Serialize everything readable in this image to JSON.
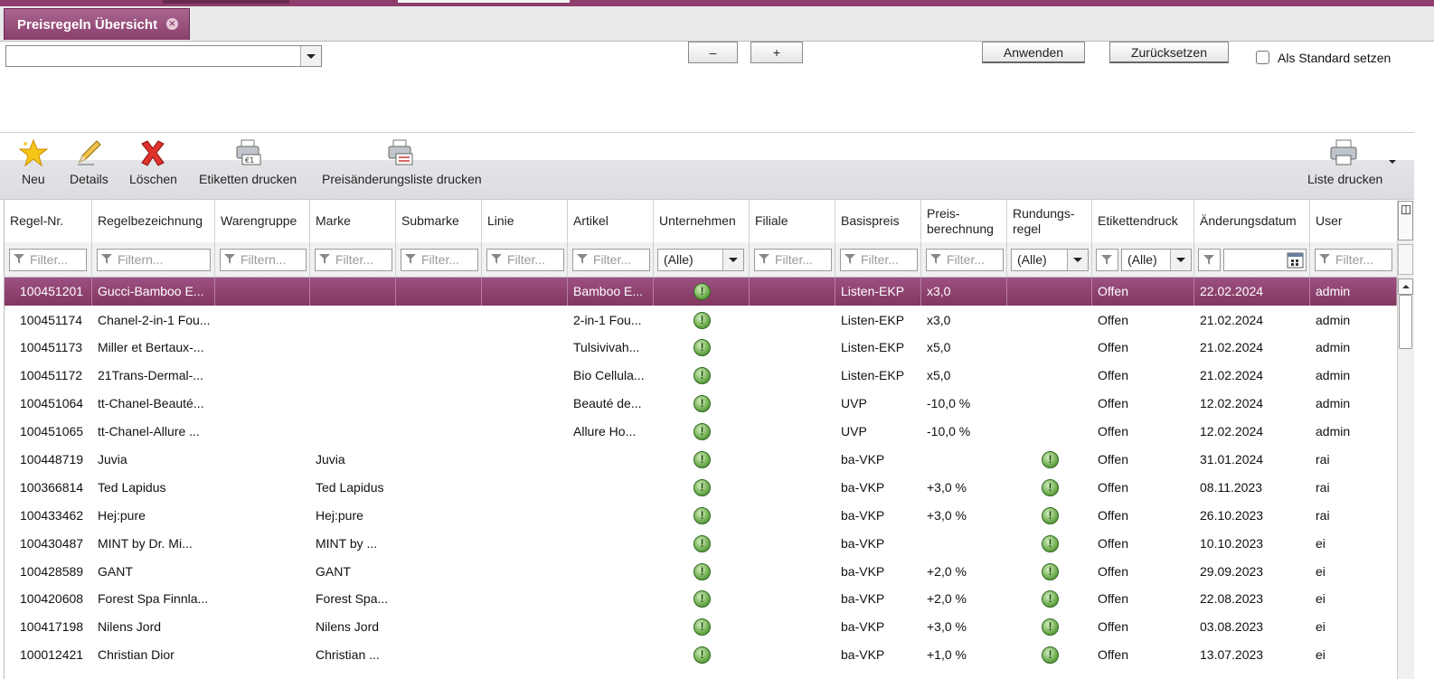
{
  "tab": {
    "title": "Preisregeln Übersicht"
  },
  "filter": {
    "combo_value": "",
    "minus_label": "–",
    "plus_label": "+",
    "apply_label": "Anwenden",
    "reset_label": "Zurücksetzen",
    "default_label": "Als Standard setzen",
    "default_checked": false
  },
  "toolbar": {
    "new": "Neu",
    "details": "Details",
    "delete": "Löschen",
    "print_labels": "Etiketten drucken",
    "print_price_changes": "Preisänderungsliste drucken",
    "print_list": "Liste drucken"
  },
  "columns": {
    "regel_nr": "Regel-Nr.",
    "regelbezeichnung": "Regelbezeichnung",
    "warengruppe": "Warengruppe",
    "marke": "Marke",
    "submarke": "Submarke",
    "linie": "Linie",
    "artikel": "Artikel",
    "unternehmen": "Unternehmen",
    "filiale": "Filiale",
    "basispreis": "Basispreis",
    "preisberechnung_1": "Preis-",
    "preisberechnung_2": "berechnung",
    "rundungsregel_1": "Rundungs-",
    "rundungsregel_2": "regel",
    "etikettendruck": "Etikettendruck",
    "aenderungsdatum": "Änderungsdatum",
    "user": "User"
  },
  "filters": {
    "placeholder_a": "Filter...",
    "placeholder_b": "Filtern...",
    "placeholder_c": "Filtern...",
    "all": "(Alle)"
  },
  "rows": [
    {
      "nr": "100451201",
      "bez": "Gucci-Bamboo E...",
      "wg": "",
      "marke": "",
      "sub": "",
      "linie": "",
      "artikel": "Bamboo E...",
      "unt": true,
      "fil": "",
      "basis": "Listen-EKP",
      "preis": "x3,0",
      "rund": false,
      "etik": "Offen",
      "datum": "22.02.2024",
      "user": "admin",
      "selected": true
    },
    {
      "nr": "100451174",
      "bez": "Chanel-2-in-1 Fou...",
      "wg": "",
      "marke": "",
      "sub": "",
      "linie": "",
      "artikel": "2-in-1 Fou...",
      "unt": true,
      "fil": "",
      "basis": "Listen-EKP",
      "preis": "x3,0",
      "rund": false,
      "etik": "Offen",
      "datum": "21.02.2024",
      "user": "admin"
    },
    {
      "nr": "100451173",
      "bez": "Miller et Bertaux-...",
      "wg": "",
      "marke": "",
      "sub": "",
      "linie": "",
      "artikel": "Tulsivivah...",
      "unt": true,
      "fil": "",
      "basis": "Listen-EKP",
      "preis": "x5,0",
      "rund": false,
      "etik": "Offen",
      "datum": "21.02.2024",
      "user": "admin"
    },
    {
      "nr": "100451172",
      "bez": "21Trans-Dermal-...",
      "wg": "",
      "marke": "",
      "sub": "",
      "linie": "",
      "artikel": "Bio Cellula...",
      "unt": true,
      "fil": "",
      "basis": "Listen-EKP",
      "preis": "x5,0",
      "rund": false,
      "etik": "Offen",
      "datum": "21.02.2024",
      "user": "admin"
    },
    {
      "nr": "100451064",
      "bez": "tt-Chanel-Beauté...",
      "wg": "",
      "marke": "",
      "sub": "",
      "linie": "",
      "artikel": "Beauté de...",
      "unt": true,
      "fil": "",
      "basis": "UVP",
      "preis": "-10,0 %",
      "rund": false,
      "etik": "Offen",
      "datum": "12.02.2024",
      "user": "admin"
    },
    {
      "nr": "100451065",
      "bez": "tt-Chanel-Allure ...",
      "wg": "",
      "marke": "",
      "sub": "",
      "linie": "",
      "artikel": "Allure Ho...",
      "unt": true,
      "fil": "",
      "basis": "UVP",
      "preis": "-10,0 %",
      "rund": false,
      "etik": "Offen",
      "datum": "12.02.2024",
      "user": "admin"
    },
    {
      "nr": "100448719",
      "bez": "Juvia",
      "wg": "",
      "marke": "Juvia",
      "sub": "",
      "linie": "",
      "artikel": "",
      "unt": true,
      "fil": "",
      "basis": "ba-VKP",
      "preis": "",
      "rund": true,
      "etik": "Offen",
      "datum": "31.01.2024",
      "user": "rai"
    },
    {
      "nr": "100366814",
      "bez": "Ted Lapidus",
      "wg": "",
      "marke": "Ted Lapidus",
      "sub": "",
      "linie": "",
      "artikel": "",
      "unt": true,
      "fil": "",
      "basis": "ba-VKP",
      "preis": "+3,0 %",
      "rund": true,
      "etik": "Offen",
      "datum": "08.11.2023",
      "user": "rai"
    },
    {
      "nr": "100433462",
      "bez": "Hej:pure",
      "wg": "",
      "marke": "Hej:pure",
      "sub": "",
      "linie": "",
      "artikel": "",
      "unt": true,
      "fil": "",
      "basis": "ba-VKP",
      "preis": "+3,0 %",
      "rund": true,
      "etik": "Offen",
      "datum": "26.10.2023",
      "user": "rai"
    },
    {
      "nr": "100430487",
      "bez": "MINT by Dr. Mi...",
      "wg": "",
      "marke": "MINT by ...",
      "sub": "",
      "linie": "",
      "artikel": "",
      "unt": true,
      "fil": "",
      "basis": "ba-VKP",
      "preis": "",
      "rund": true,
      "etik": "Offen",
      "datum": "10.10.2023",
      "user": "ei"
    },
    {
      "nr": "100428589",
      "bez": "GANT",
      "wg": "",
      "marke": "GANT",
      "sub": "",
      "linie": "",
      "artikel": "",
      "unt": true,
      "fil": "",
      "basis": "ba-VKP",
      "preis": "+2,0 %",
      "rund": true,
      "etik": "Offen",
      "datum": "29.09.2023",
      "user": "ei"
    },
    {
      "nr": "100420608",
      "bez": "Forest Spa Finnla...",
      "wg": "",
      "marke": "Forest Spa...",
      "sub": "",
      "linie": "",
      "artikel": "",
      "unt": true,
      "fil": "",
      "basis": "ba-VKP",
      "preis": "+2,0 %",
      "rund": true,
      "etik": "Offen",
      "datum": "22.08.2023",
      "user": "ei"
    },
    {
      "nr": "100417198",
      "bez": "Nilens Jord",
      "wg": "",
      "marke": "Nilens Jord",
      "sub": "",
      "linie": "",
      "artikel": "",
      "unt": true,
      "fil": "",
      "basis": "ba-VKP",
      "preis": "+3,0 %",
      "rund": true,
      "etik": "Offen",
      "datum": "03.08.2023",
      "user": "ei"
    },
    {
      "nr": "100012421",
      "bez": "Christian Dior",
      "wg": "",
      "marke": "Christian ...",
      "sub": "",
      "linie": "",
      "artikel": "",
      "unt": true,
      "fil": "",
      "basis": "ba-VKP",
      "preis": "+1,0 %",
      "rund": true,
      "etik": "Offen",
      "datum": "13.07.2023",
      "user": "ei"
    }
  ],
  "colors": {
    "accent": "#8a3f6c",
    "selected_row": "#8c4070",
    "status_green": "#6dab4c"
  },
  "icons": {
    "new": "star-icon",
    "details": "pencil-icon",
    "delete": "red-x-icon",
    "print": "printer-icon"
  }
}
